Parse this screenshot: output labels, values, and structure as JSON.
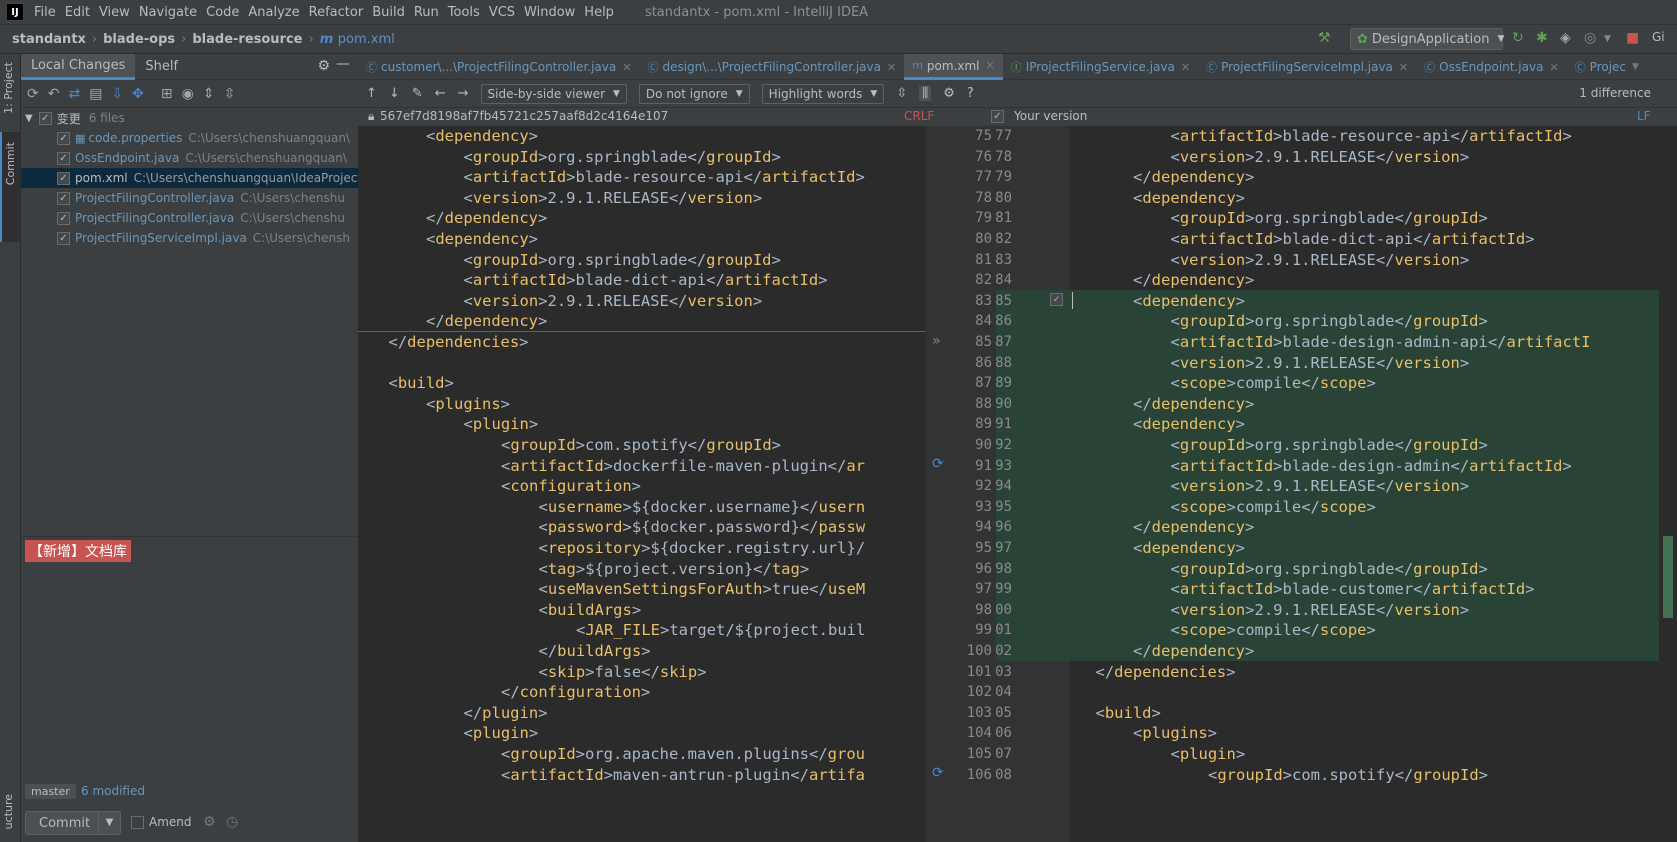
{
  "menubar": {
    "logo": "IJ",
    "items": [
      "File",
      "Edit",
      "View",
      "Navigate",
      "Code",
      "Analyze",
      "Refactor",
      "Build",
      "Run",
      "Tools",
      "VCS",
      "Window",
      "Help"
    ],
    "title": "standantx - pom.xml - IntelliJ IDEA"
  },
  "breadcrumb": {
    "project": "standantx",
    "module": "blade-ops",
    "submodule": "blade-resource",
    "file": "pom.xml"
  },
  "run_config": {
    "label": "DesignApplication"
  },
  "left_strip": {
    "project_tab": "1: Project",
    "commit_tab": "Commit",
    "structure_tab": "ucture"
  },
  "panel": {
    "tabs": [
      "Local Changes",
      "Shelf"
    ],
    "group": {
      "label": "变更",
      "count": "6 files"
    },
    "files": [
      {
        "name": "code.properties",
        "path": "C:\\Users\\chenshuangquan\\"
      },
      {
        "name": "OssEndpoint.java",
        "path": "C:\\Users\\chenshuangquan\\"
      },
      {
        "name": "pom.xml",
        "path": "C:\\Users\\chenshuangquan\\IdeaProjects\\standantx\\blade-ops\\blade-resource"
      },
      {
        "name": "ProjectFilingController.java",
        "path": "C:\\Users\\chenshu"
      },
      {
        "name": "ProjectFilingController.java",
        "path": "C:\\Users\\chenshu"
      },
      {
        "name": "ProjectFilingServiceImpl.java",
        "path": "C:\\Users\\chensh"
      }
    ],
    "tag": "【新增】文档库",
    "branch": "master",
    "modified": "6 modified",
    "commit_label": "Commit",
    "amend_label": "Amend"
  },
  "editor_tabs": [
    {
      "label": "customer\\...\\ProjectFilingController.java",
      "active": false
    },
    {
      "label": "design\\...\\ProjectFilingController.java",
      "active": false
    },
    {
      "label": "pom.xml",
      "active": true
    },
    {
      "label": "IProjectFilingService.java",
      "active": false
    },
    {
      "label": "ProjectFilingServiceImpl.java",
      "active": false
    },
    {
      "label": "OssEndpoint.java",
      "active": false
    },
    {
      "label": "Projec",
      "active": false
    }
  ],
  "diff_toolbar": {
    "viewer": "Side-by-side viewer",
    "ignore": "Do not ignore",
    "highlight": "Highlight words",
    "difference_count": "1 difference"
  },
  "diff_header": {
    "left_revision": "567ef7d8198af7fb45721c257aaf8d2c4164e107",
    "left_line_sep": "CRLF",
    "right_title": "Your version",
    "right_line_sep": "LF"
  },
  "left_code": [
    {
      "n": 75,
      "indent": 2,
      "tag": "dependency",
      "kind": "open"
    },
    {
      "n": 76,
      "indent": 3,
      "tag": "groupId",
      "text": "org.springblade",
      "kind": "full"
    },
    {
      "n": 77,
      "indent": 3,
      "tag": "artifactId",
      "text": "blade-resource-api",
      "kind": "full"
    },
    {
      "n": 78,
      "indent": 3,
      "tag": "version",
      "text": "2.9.1.RELEASE",
      "kind": "full"
    },
    {
      "n": 79,
      "indent": 2,
      "tag": "dependency",
      "kind": "close"
    },
    {
      "n": 80,
      "indent": 2,
      "tag": "dependency",
      "kind": "open"
    },
    {
      "n": 81,
      "indent": 3,
      "tag": "groupId",
      "text": "org.springblade",
      "kind": "full"
    },
    {
      "n": 82,
      "indent": 3,
      "tag": "artifactId",
      "text": "blade-dict-api",
      "kind": "full"
    },
    {
      "n": 83,
      "indent": 3,
      "tag": "version",
      "text": "2.9.1.RELEASE",
      "kind": "full"
    },
    {
      "n": 84,
      "indent": 2,
      "tag": "dependency",
      "kind": "close"
    },
    {
      "n": 85,
      "indent": 1,
      "tag": "dependencies",
      "kind": "close"
    },
    {
      "n": 86,
      "indent": 0,
      "kind": "blank"
    },
    {
      "n": 87,
      "indent": 1,
      "tag": "build",
      "kind": "open"
    },
    {
      "n": 88,
      "indent": 2,
      "tag": "plugins",
      "kind": "open"
    },
    {
      "n": 89,
      "indent": 3,
      "tag": "plugin",
      "kind": "open"
    },
    {
      "n": 90,
      "indent": 4,
      "tag": "groupId",
      "text": "com.spotify",
      "kind": "full"
    },
    {
      "n": 91,
      "indent": 4,
      "tag": "artifactId",
      "text": "dockerfile-maven-plugin",
      "kind": "partial",
      "tail": "ar"
    },
    {
      "n": 92,
      "indent": 4,
      "tag": "configuration",
      "kind": "open"
    },
    {
      "n": 93,
      "indent": 5,
      "tag": "username",
      "text": "${docker.username}",
      "kind": "partial",
      "tail": "usern"
    },
    {
      "n": 94,
      "indent": 5,
      "tag": "password",
      "text": "${docker.password}",
      "kind": "partial",
      "tail": "passw"
    },
    {
      "n": 95,
      "indent": 5,
      "tag": "repository",
      "text": "${docker.registry.url}/",
      "kind": "cut"
    },
    {
      "n": 96,
      "indent": 5,
      "tag": "tag",
      "text": "${project.version}",
      "kind": "full"
    },
    {
      "n": 97,
      "indent": 5,
      "tag": "useMavenSettingsForAuth",
      "text": "true",
      "kind": "partial",
      "tail": "useM"
    },
    {
      "n": 98,
      "indent": 5,
      "tag": "buildArgs",
      "kind": "open"
    },
    {
      "n": 99,
      "indent": 6,
      "tag": "JAR_FILE",
      "text": "target/${project.buil",
      "kind": "cut"
    },
    {
      "n": 100,
      "indent": 5,
      "tag": "buildArgs",
      "kind": "close"
    },
    {
      "n": 101,
      "indent": 5,
      "tag": "skip",
      "text": "false",
      "kind": "full"
    },
    {
      "n": 102,
      "indent": 4,
      "tag": "configuration",
      "kind": "close"
    },
    {
      "n": 103,
      "indent": 3,
      "tag": "plugin",
      "kind": "close"
    },
    {
      "n": 104,
      "indent": 3,
      "tag": "plugin",
      "kind": "open"
    },
    {
      "n": 105,
      "indent": 4,
      "tag": "groupId",
      "text": "org.apache.maven.plugins",
      "kind": "partial",
      "tail": "grou"
    },
    {
      "n": 106,
      "indent": 4,
      "tag": "artifactId",
      "text": "maven-antrun-plugin",
      "kind": "partial",
      "tail": "artifa"
    }
  ],
  "right_code": [
    {
      "n": 77,
      "indent": 3,
      "tag": "artifactId",
      "text": "blade-resource-api",
      "kind": "full"
    },
    {
      "n": 78,
      "indent": 3,
      "tag": "version",
      "text": "2.9.1.RELEASE",
      "kind": "full"
    },
    {
      "n": 79,
      "indent": 2,
      "tag": "dependency",
      "kind": "close"
    },
    {
      "n": 80,
      "indent": 2,
      "tag": "dependency",
      "kind": "open"
    },
    {
      "n": 81,
      "indent": 3,
      "tag": "groupId",
      "text": "org.springblade",
      "kind": "full"
    },
    {
      "n": 82,
      "indent": 3,
      "tag": "artifactId",
      "text": "blade-dict-api",
      "kind": "full"
    },
    {
      "n": 83,
      "indent": 3,
      "tag": "version",
      "text": "2.9.1.RELEASE",
      "kind": "full"
    },
    {
      "n": 84,
      "indent": 2,
      "tag": "dependency",
      "kind": "close"
    },
    {
      "n": 85,
      "indent": 2,
      "tag": "dependency",
      "kind": "open",
      "added": true
    },
    {
      "n": 86,
      "indent": 3,
      "tag": "groupId",
      "text": "org.springblade",
      "kind": "full",
      "added": true
    },
    {
      "n": 87,
      "indent": 3,
      "tag": "artifactId",
      "text": "blade-design-admin-api",
      "kind": "partial",
      "tail": "artifactI",
      "added": true
    },
    {
      "n": 88,
      "indent": 3,
      "tag": "version",
      "text": "2.9.1.RELEASE",
      "kind": "full",
      "added": true
    },
    {
      "n": 89,
      "indent": 3,
      "tag": "scope",
      "text": "compile",
      "kind": "full",
      "added": true
    },
    {
      "n": 90,
      "indent": 2,
      "tag": "dependency",
      "kind": "close",
      "added": true
    },
    {
      "n": 91,
      "indent": 2,
      "tag": "dependency",
      "kind": "open",
      "added": true
    },
    {
      "n": 92,
      "indent": 3,
      "tag": "groupId",
      "text": "org.springblade",
      "kind": "full",
      "added": true
    },
    {
      "n": 93,
      "indent": 3,
      "tag": "artifactId",
      "text": "blade-design-admin",
      "kind": "full",
      "added": true
    },
    {
      "n": 94,
      "indent": 3,
      "tag": "version",
      "text": "2.9.1.RELEASE",
      "kind": "full",
      "added": true
    },
    {
      "n": 95,
      "indent": 3,
      "tag": "scope",
      "text": "compile",
      "kind": "full",
      "added": true
    },
    {
      "n": 96,
      "indent": 2,
      "tag": "dependency",
      "kind": "close",
      "added": true
    },
    {
      "n": 97,
      "indent": 2,
      "tag": "dependency",
      "kind": "open",
      "added": true
    },
    {
      "n": 98,
      "indent": 3,
      "tag": "groupId",
      "text": "org.springblade",
      "kind": "full",
      "added": true
    },
    {
      "n": 99,
      "indent": 3,
      "tag": "artifactId",
      "text": "blade-customer",
      "kind": "full",
      "added": true
    },
    {
      "n": 100,
      "indent": 3,
      "tag": "version",
      "text": "2.9.1.RELEASE",
      "kind": "full",
      "added": true
    },
    {
      "n": 101,
      "indent": 3,
      "tag": "scope",
      "text": "compile",
      "kind": "full",
      "added": true
    },
    {
      "n": 102,
      "indent": 2,
      "tag": "dependency",
      "kind": "close",
      "added": true
    },
    {
      "n": 103,
      "indent": 1,
      "tag": "dependencies",
      "kind": "close"
    },
    {
      "n": 104,
      "indent": 0,
      "kind": "blank"
    },
    {
      "n": 105,
      "indent": 1,
      "tag": "build",
      "kind": "open"
    },
    {
      "n": 106,
      "indent": 2,
      "tag": "plugins",
      "kind": "open"
    },
    {
      "n": 107,
      "indent": 3,
      "tag": "plugin",
      "kind": "open"
    },
    {
      "n": 108,
      "indent": 4,
      "tag": "groupId",
      "text": "com.spotify",
      "kind": "full"
    }
  ]
}
